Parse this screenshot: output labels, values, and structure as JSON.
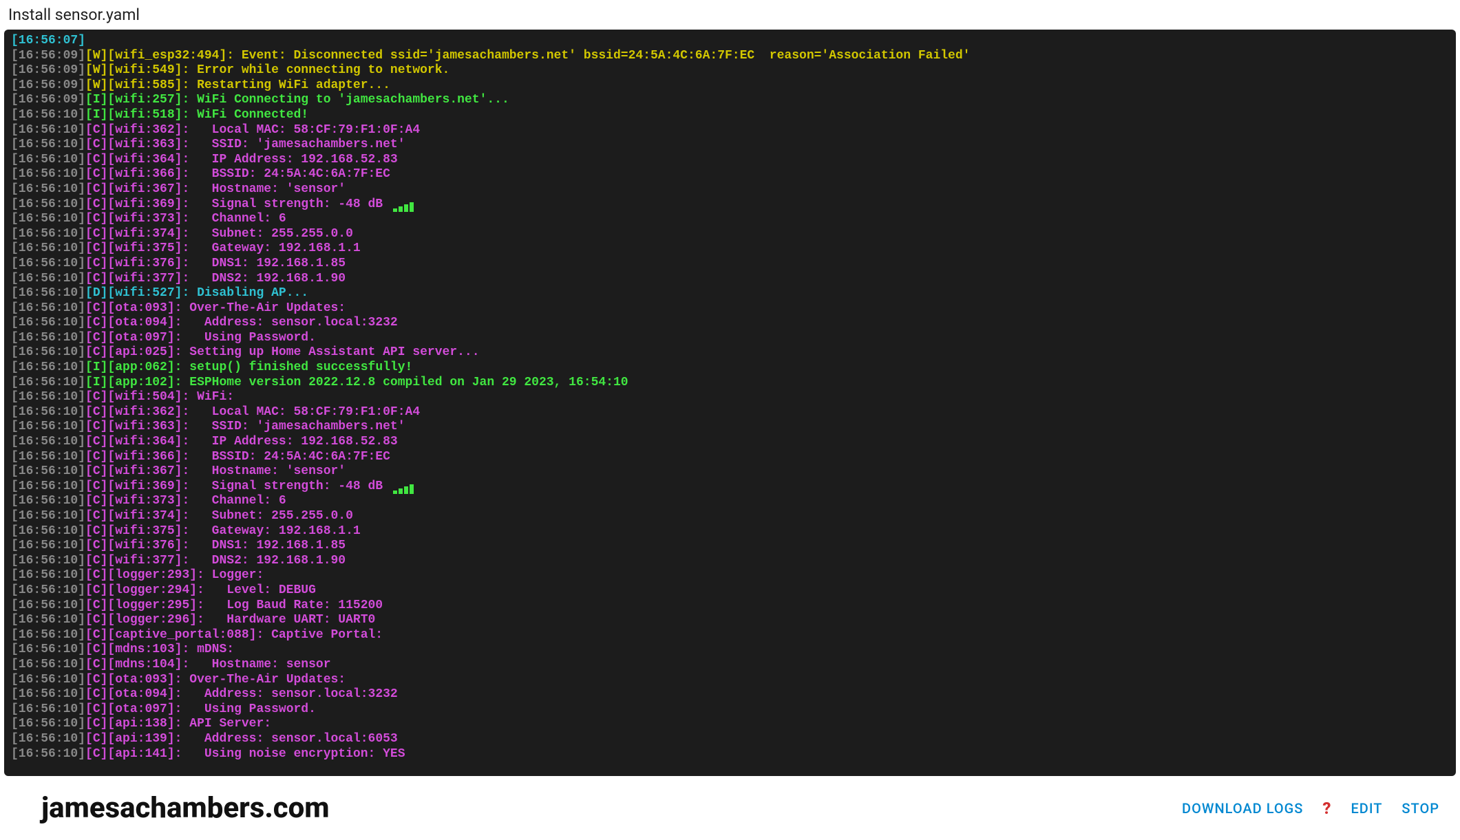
{
  "header": {
    "title": "Install sensor.yaml"
  },
  "footer": {
    "brand": "jamesachambers.com",
    "download_label": "DOWNLOAD LOGS",
    "help_symbol": "?",
    "edit_label": "EDIT",
    "stop_label": "STOP"
  },
  "log": {
    "lines": [
      {
        "ts": "[16:56:07]",
        "lvl": "",
        "tag": "",
        "msg": ""
      },
      {
        "ts": "[16:56:09]",
        "lvl": "W",
        "tag": "[wifi_esp32:494]",
        "msg": " Event: Disconnected ssid='jamesachambers.net' bssid=24:5A:4C:6A:7F:EC  reason='Association Failed'"
      },
      {
        "ts": "[16:56:09]",
        "lvl": "W",
        "tag": "[wifi:549]",
        "msg": " Error while connecting to network."
      },
      {
        "ts": "[16:56:09]",
        "lvl": "W",
        "tag": "[wifi:585]",
        "msg": " Restarting WiFi adapter..."
      },
      {
        "ts": "[16:56:09]",
        "lvl": "I",
        "tag": "[wifi:257]",
        "msg": " WiFi Connecting to 'jamesachambers.net'..."
      },
      {
        "ts": "[16:56:10]",
        "lvl": "I",
        "tag": "[wifi:518]",
        "msg": " WiFi Connected!"
      },
      {
        "ts": "[16:56:10]",
        "lvl": "C",
        "tag": "[wifi:362]",
        "msg": "   Local MAC: 58:CF:79:F1:0F:A4"
      },
      {
        "ts": "[16:56:10]",
        "lvl": "C",
        "tag": "[wifi:363]",
        "msg": "   SSID: 'jamesachambers.net'"
      },
      {
        "ts": "[16:56:10]",
        "lvl": "C",
        "tag": "[wifi:364]",
        "msg": "   IP Address: 192.168.52.83"
      },
      {
        "ts": "[16:56:10]",
        "lvl": "C",
        "tag": "[wifi:366]",
        "msg": "   BSSID: 24:5A:4C:6A:7F:EC"
      },
      {
        "ts": "[16:56:10]",
        "lvl": "C",
        "tag": "[wifi:367]",
        "msg": "   Hostname: 'sensor'"
      },
      {
        "ts": "[16:56:10]",
        "lvl": "C",
        "tag": "[wifi:369]",
        "msg": "   Signal strength: -48 dB ",
        "signal": true
      },
      {
        "ts": "[16:56:10]",
        "lvl": "C",
        "tag": "[wifi:373]",
        "msg": "   Channel: 6"
      },
      {
        "ts": "[16:56:10]",
        "lvl": "C",
        "tag": "[wifi:374]",
        "msg": "   Subnet: 255.255.0.0"
      },
      {
        "ts": "[16:56:10]",
        "lvl": "C",
        "tag": "[wifi:375]",
        "msg": "   Gateway: 192.168.1.1"
      },
      {
        "ts": "[16:56:10]",
        "lvl": "C",
        "tag": "[wifi:376]",
        "msg": "   DNS1: 192.168.1.85"
      },
      {
        "ts": "[16:56:10]",
        "lvl": "C",
        "tag": "[wifi:377]",
        "msg": "   DNS2: 192.168.1.90"
      },
      {
        "ts": "[16:56:10]",
        "lvl": "D",
        "tag": "[wifi:527]",
        "msg": " Disabling AP..."
      },
      {
        "ts": "[16:56:10]",
        "lvl": "C",
        "tag": "[ota:093]",
        "msg": " Over-The-Air Updates:"
      },
      {
        "ts": "[16:56:10]",
        "lvl": "C",
        "tag": "[ota:094]",
        "msg": "   Address: sensor.local:3232"
      },
      {
        "ts": "[16:56:10]",
        "lvl": "C",
        "tag": "[ota:097]",
        "msg": "   Using Password."
      },
      {
        "ts": "[16:56:10]",
        "lvl": "C",
        "tag": "[api:025]",
        "msg": " Setting up Home Assistant API server..."
      },
      {
        "ts": "[16:56:10]",
        "lvl": "I",
        "tag": "[app:062]",
        "msg": " setup() finished successfully!"
      },
      {
        "ts": "[16:56:10]",
        "lvl": "I",
        "tag": "[app:102]",
        "msg": " ESPHome version 2022.12.8 compiled on Jan 29 2023, 16:54:10"
      },
      {
        "ts": "[16:56:10]",
        "lvl": "C",
        "tag": "[wifi:504]",
        "msg": " WiFi:"
      },
      {
        "ts": "[16:56:10]",
        "lvl": "C",
        "tag": "[wifi:362]",
        "msg": "   Local MAC: 58:CF:79:F1:0F:A4"
      },
      {
        "ts": "[16:56:10]",
        "lvl": "C",
        "tag": "[wifi:363]",
        "msg": "   SSID: 'jamesachambers.net'"
      },
      {
        "ts": "[16:56:10]",
        "lvl": "C",
        "tag": "[wifi:364]",
        "msg": "   IP Address: 192.168.52.83"
      },
      {
        "ts": "[16:56:10]",
        "lvl": "C",
        "tag": "[wifi:366]",
        "msg": "   BSSID: 24:5A:4C:6A:7F:EC"
      },
      {
        "ts": "[16:56:10]",
        "lvl": "C",
        "tag": "[wifi:367]",
        "msg": "   Hostname: 'sensor'"
      },
      {
        "ts": "[16:56:10]",
        "lvl": "C",
        "tag": "[wifi:369]",
        "msg": "   Signal strength: -48 dB ",
        "signal": true
      },
      {
        "ts": "[16:56:10]",
        "lvl": "C",
        "tag": "[wifi:373]",
        "msg": "   Channel: 6"
      },
      {
        "ts": "[16:56:10]",
        "lvl": "C",
        "tag": "[wifi:374]",
        "msg": "   Subnet: 255.255.0.0"
      },
      {
        "ts": "[16:56:10]",
        "lvl": "C",
        "tag": "[wifi:375]",
        "msg": "   Gateway: 192.168.1.1"
      },
      {
        "ts": "[16:56:10]",
        "lvl": "C",
        "tag": "[wifi:376]",
        "msg": "   DNS1: 192.168.1.85"
      },
      {
        "ts": "[16:56:10]",
        "lvl": "C",
        "tag": "[wifi:377]",
        "msg": "   DNS2: 192.168.1.90"
      },
      {
        "ts": "[16:56:10]",
        "lvl": "C",
        "tag": "[logger:293]",
        "msg": " Logger:"
      },
      {
        "ts": "[16:56:10]",
        "lvl": "C",
        "tag": "[logger:294]",
        "msg": "   Level: DEBUG"
      },
      {
        "ts": "[16:56:10]",
        "lvl": "C",
        "tag": "[logger:295]",
        "msg": "   Log Baud Rate: 115200"
      },
      {
        "ts": "[16:56:10]",
        "lvl": "C",
        "tag": "[logger:296]",
        "msg": "   Hardware UART: UART0"
      },
      {
        "ts": "[16:56:10]",
        "lvl": "C",
        "tag": "[captive_portal:088]",
        "msg": " Captive Portal:"
      },
      {
        "ts": "[16:56:10]",
        "lvl": "C",
        "tag": "[mdns:103]",
        "msg": " mDNS:"
      },
      {
        "ts": "[16:56:10]",
        "lvl": "C",
        "tag": "[mdns:104]",
        "msg": "   Hostname: sensor"
      },
      {
        "ts": "[16:56:10]",
        "lvl": "C",
        "tag": "[ota:093]",
        "msg": " Over-The-Air Updates:"
      },
      {
        "ts": "[16:56:10]",
        "lvl": "C",
        "tag": "[ota:094]",
        "msg": "   Address: sensor.local:3232"
      },
      {
        "ts": "[16:56:10]",
        "lvl": "C",
        "tag": "[ota:097]",
        "msg": "   Using Password."
      },
      {
        "ts": "[16:56:10]",
        "lvl": "C",
        "tag": "[api:138]",
        "msg": " API Server:"
      },
      {
        "ts": "[16:56:10]",
        "lvl": "C",
        "tag": "[api:139]",
        "msg": "   Address: sensor.local:6053"
      },
      {
        "ts": "[16:56:10]",
        "lvl": "C",
        "tag": "[api:141]",
        "msg": "   Using noise encryption: YES"
      }
    ]
  }
}
